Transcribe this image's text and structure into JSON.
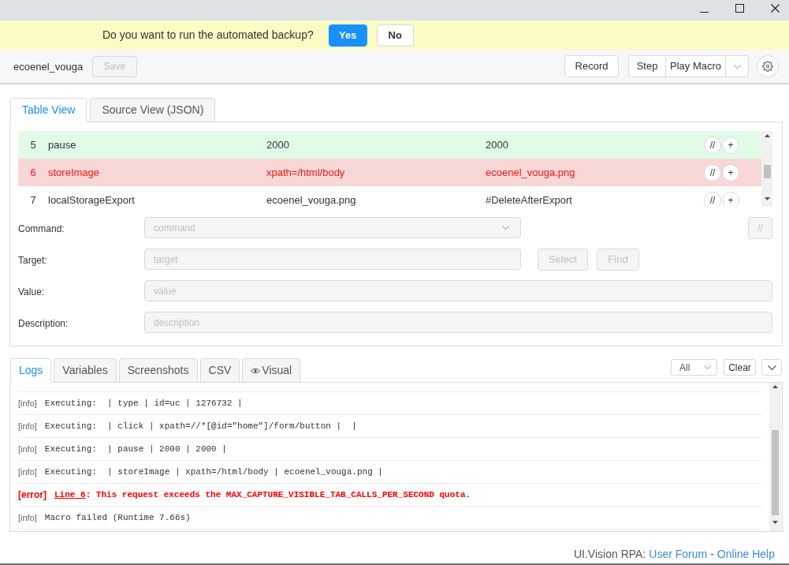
{
  "notification": {
    "message": "Do you want to run the automated backup?",
    "buttons": [
      {
        "label": "Yes",
        "kind": "primary"
      },
      {
        "label": "No",
        "kind": "default"
      }
    ]
  },
  "toolbar": {
    "macro_name": "ecoenel_vouga",
    "save_button": {
      "label": "Save",
      "disabled": true
    },
    "record_button": "Record",
    "play_buttons": [
      "Step",
      "Play Macro"
    ]
  },
  "editor_tabs": [
    {
      "label": "Table View",
      "selected": true
    },
    {
      "label": "Source View (JSON)",
      "selected": false
    }
  ],
  "table": {
    "rows": [
      {
        "index": "5",
        "command": "pause",
        "target": "2000",
        "value": "2000",
        "kind": "passed",
        "actions": [
          "//",
          "+"
        ]
      },
      {
        "index": "6",
        "command": "storeImage",
        "target": "xpath=/html/body",
        "value": "ecoenel_vouga.png",
        "kind": "failed",
        "actions": [
          "//",
          "+"
        ]
      },
      {
        "index": "7",
        "command": "localStorageExport",
        "target": "ecoenel_vouga.png",
        "value": "#DeleteAfterExport",
        "kind": "plain",
        "actions": [
          "//",
          "+"
        ]
      }
    ]
  },
  "form": {
    "fields": [
      {
        "kind": "select",
        "label": "Command:",
        "placeholder": "command"
      },
      {
        "kind": "target",
        "label": "Target:",
        "placeholder": "target"
      },
      {
        "kind": "text",
        "label": "Value:",
        "placeholder": "value"
      },
      {
        "kind": "text",
        "label": "Description:",
        "placeholder": "description"
      }
    ],
    "comment_button": "//",
    "target_buttons": [
      {
        "label": "Select",
        "disabled": true
      },
      {
        "label": "Find",
        "disabled": true
      }
    ]
  },
  "log_tabs": [
    {
      "label": "Logs",
      "selected": true,
      "kind": "text"
    },
    {
      "label": "Variables",
      "selected": false,
      "kind": "text"
    },
    {
      "label": "Screenshots",
      "selected": false,
      "kind": "text"
    },
    {
      "label": "CSV",
      "selected": false,
      "kind": "text"
    },
    {
      "label": "Visual",
      "selected": false,
      "kind": "icon_text"
    }
  ],
  "log_controls": {
    "filter": "All",
    "clear_button": "Clear"
  },
  "logs": [
    {
      "kind": "info",
      "tag": "[info]",
      "text": "Executing:  | type | id=uc | 1276732 |"
    },
    {
      "kind": "info",
      "tag": "[info]",
      "text": "Executing:  | click | xpath=//*[@id=\"home\"]/form/button |  |"
    },
    {
      "kind": "info",
      "tag": "[info]",
      "text": "Executing:  | pause | 2000 | 2000 |"
    },
    {
      "kind": "info",
      "tag": "[info]",
      "text": "Executing:  | storeImage | xpath=/html/body | ecoenel_vouga.png |"
    },
    {
      "kind": "error",
      "tag": "[error]",
      "link": "Line 6",
      "text": ": This request exceeds the MAX_CAPTURE_VISIBLE_TAB_CALLS_PER_SECOND quota."
    },
    {
      "kind": "info",
      "tag": "[info]",
      "text": "Macro failed (Runtime 7.66s)"
    }
  ],
  "footer": {
    "product": "UI.Vision RPA:",
    "links": [
      "User Forum",
      "Online Help"
    ],
    "separator": "-"
  }
}
